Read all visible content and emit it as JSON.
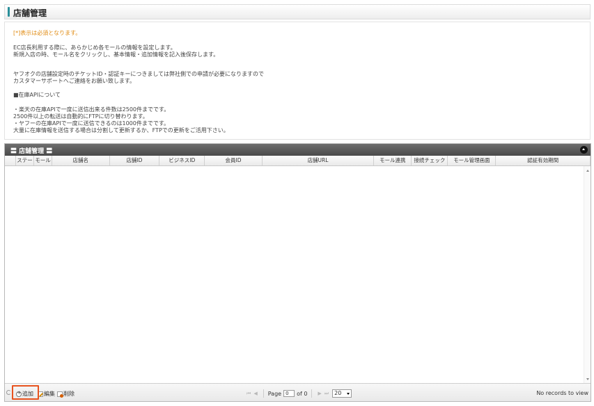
{
  "page": {
    "title": "店舗管理"
  },
  "info": {
    "required_note": "[*]表示は必須となります。",
    "lines": [
      "EC店長利用する際に、あらかじめ各モールの情報を設定します。",
      "新規入店の時、モール名をクリックし、基本情報・追加情報を記入後保存します。",
      "ヤフオクの店舗設定時のチケットID・認証キーにつきましては弊社側での申請が必要になりますので",
      "カスタマーサポートへご連絡をお願い致します。",
      "■在庫APIについて",
      "・楽天の在庫APIで一度に送信出来る件数は2500件までです。",
      "2500件以上の転送は自動的にFTPに切り替わります。",
      "・ヤフーの在庫APIで一度に送信できるのは1000件までです。",
      "大量に在庫情報を送信する場合は分割して更新するか、FTPでの更新をご活用下さい。"
    ]
  },
  "grid": {
    "caption": "〓 店舗管理 〓",
    "columns": [
      "ステー",
      "モール",
      "店舗名",
      "店舗ID",
      "ビジネスID",
      "会員ID",
      "店舗URL",
      "モール連携",
      "接続チェック",
      "モール管理画面",
      "認証有効期間"
    ],
    "rows": []
  },
  "pager": {
    "add_label": "追加",
    "edit_label": "編集",
    "delete_label": "削除",
    "page_label": "Page",
    "page_value": "0",
    "of_label": "of 0",
    "rows_per_page": "20",
    "records_text": "No records to view"
  },
  "colors": {
    "accent": "#2a8f9a",
    "highlight": "#e8531f",
    "required": "#e08a10"
  }
}
